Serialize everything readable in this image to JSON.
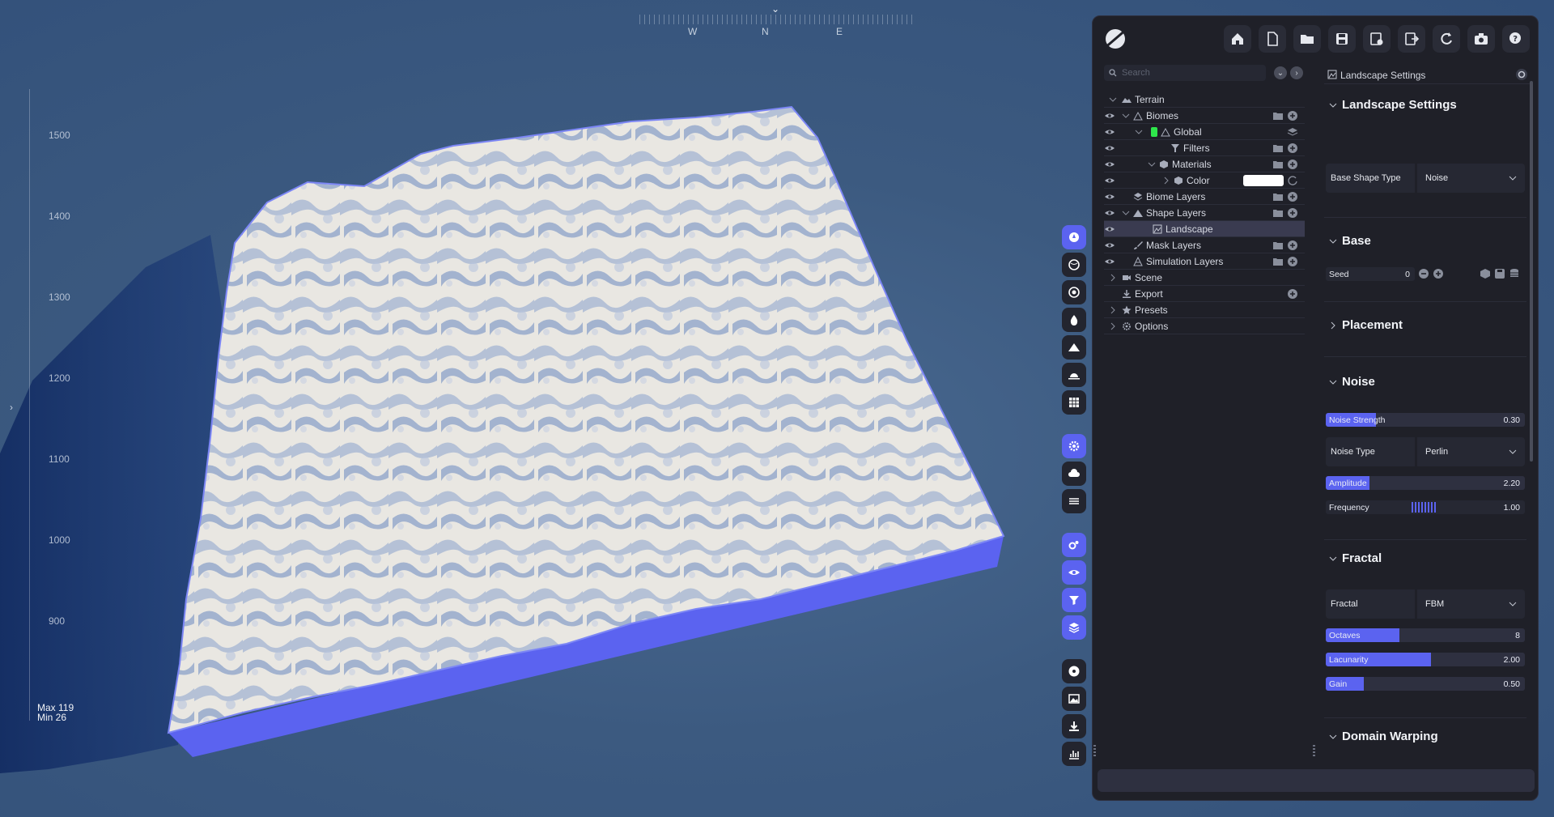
{
  "colors": {
    "accent": "#5b63f0",
    "panel_bg": "#1f2028",
    "terrain_side": "#5b63f0",
    "biome_chip": "#2ee64b",
    "material_color": "#ffffff"
  },
  "viewport": {
    "compass": {
      "letters": [
        "W",
        "N",
        "E"
      ]
    },
    "ruler": {
      "labels": [
        "1500",
        "1400",
        "1300",
        "1200",
        "1100",
        "1000",
        "900"
      ],
      "max_text": "Max 119",
      "min_text": "Min 26"
    }
  },
  "tool_strip": {
    "icons": [
      "rocket-icon",
      "globe-icon",
      "target-icon",
      "water-drop-icon",
      "mountain-icon",
      "sunrise-icon",
      "grid-icon",
      "gear-icon",
      "cloud-icon",
      "layers-lines-icon",
      "cogs-icon",
      "eye-icon",
      "filter-icon",
      "stack-icon",
      "disc-icon",
      "image-icon",
      "download-icon",
      "chart-icon"
    ],
    "active": [
      "rocket-icon",
      "gear-icon",
      "cogs-icon",
      "eye-icon",
      "filter-icon",
      "stack-icon"
    ]
  },
  "header": {
    "buttons": [
      "home-icon",
      "new-file-icon",
      "open-folder-icon",
      "save-icon",
      "export-settings-icon",
      "export-icon",
      "refresh-icon",
      "camera-icon",
      "help-icon"
    ]
  },
  "tree": {
    "search_placeholder": "Search",
    "items": [
      {
        "label": "Terrain",
        "icon": "terrain-icon"
      },
      {
        "label": "Biomes",
        "icon": "biome-icon"
      },
      {
        "label": "Global",
        "icon": "biome-icon"
      },
      {
        "label": "Filters",
        "icon": "filter-icon"
      },
      {
        "label": "Materials",
        "icon": "cube-icon"
      },
      {
        "label": "Color",
        "icon": "cube-icon"
      },
      {
        "label": "Biome Layers",
        "icon": "layers-icon"
      },
      {
        "label": "Shape Layers",
        "icon": "mountain-icon"
      },
      {
        "label": "Landscape",
        "icon": "landscape-icon"
      },
      {
        "label": "Mask Layers",
        "icon": "brush-icon"
      },
      {
        "label": "Simulation Layers",
        "icon": "simulation-icon"
      },
      {
        "label": "Scene",
        "icon": "camera-icon"
      },
      {
        "label": "Export",
        "icon": "download-icon"
      },
      {
        "label": "Presets",
        "icon": "star-icon"
      },
      {
        "label": "Options",
        "icon": "gear-icon"
      }
    ],
    "selected": "Landscape"
  },
  "settings": {
    "title": "Landscape Settings",
    "sections": {
      "landscape": {
        "title": "Landscape Settings",
        "base_shape_type": {
          "label": "Base Shape Type",
          "value": "Noise"
        }
      },
      "base": {
        "title": "Base",
        "seed": {
          "label": "Seed",
          "value": "0"
        }
      },
      "placement": {
        "title": "Placement"
      },
      "noise": {
        "title": "Noise",
        "noise_strength": {
          "label": "Noise Strength",
          "value": "0.30",
          "fraction": 0.25
        },
        "noise_type": {
          "label": "Noise Type",
          "value": "Perlin"
        },
        "amplitude": {
          "label": "Amplitude",
          "value": "2.20",
          "fraction": 0.22
        },
        "frequency": {
          "label": "Frequency",
          "value": "1.00"
        }
      },
      "fractal": {
        "title": "Fractal",
        "fractal": {
          "label": "Fractal",
          "value": "FBM"
        },
        "octaves": {
          "label": "Octaves",
          "value": "8",
          "fraction": 0.37
        },
        "lacunarity": {
          "label": "Lacunarity",
          "value": "2.00",
          "fraction": 0.53
        },
        "gain": {
          "label": "Gain",
          "value": "0.50",
          "fraction": 0.19
        }
      },
      "domain_warping": {
        "title": "Domain Warping"
      }
    }
  }
}
